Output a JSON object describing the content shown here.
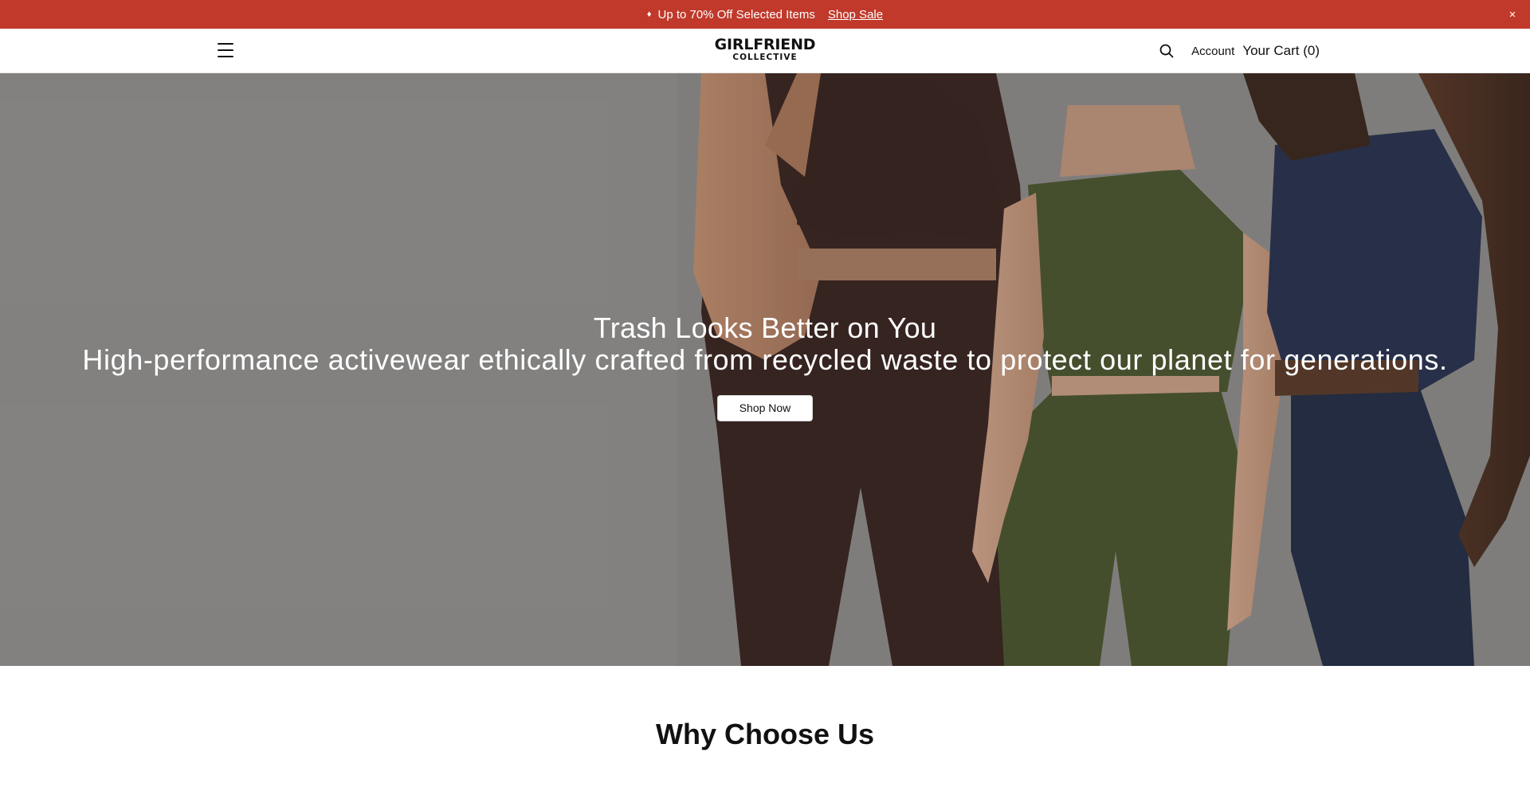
{
  "announcement": {
    "icon": "tag-icon",
    "text": "Up to 70% Off Selected Items",
    "link": "Shop Sale",
    "close_icon": "close-icon",
    "background": "#c0392b"
  },
  "header": {
    "logo_line1": "GIRLFRIEND",
    "logo_line2": "COLLECTIVE",
    "menu_icon": "hamburger-menu-icon",
    "search_icon": "search-icon",
    "account_label": "Account",
    "cart_label": "Your Cart (0)"
  },
  "hero": {
    "title": "Trash Looks Better on You",
    "subtitle": "High-performance activewear ethically crafted from recycled waste to protect our planet for generations.",
    "cta_label": "Shop Now"
  },
  "why": {
    "title": "Why Choose Us"
  }
}
